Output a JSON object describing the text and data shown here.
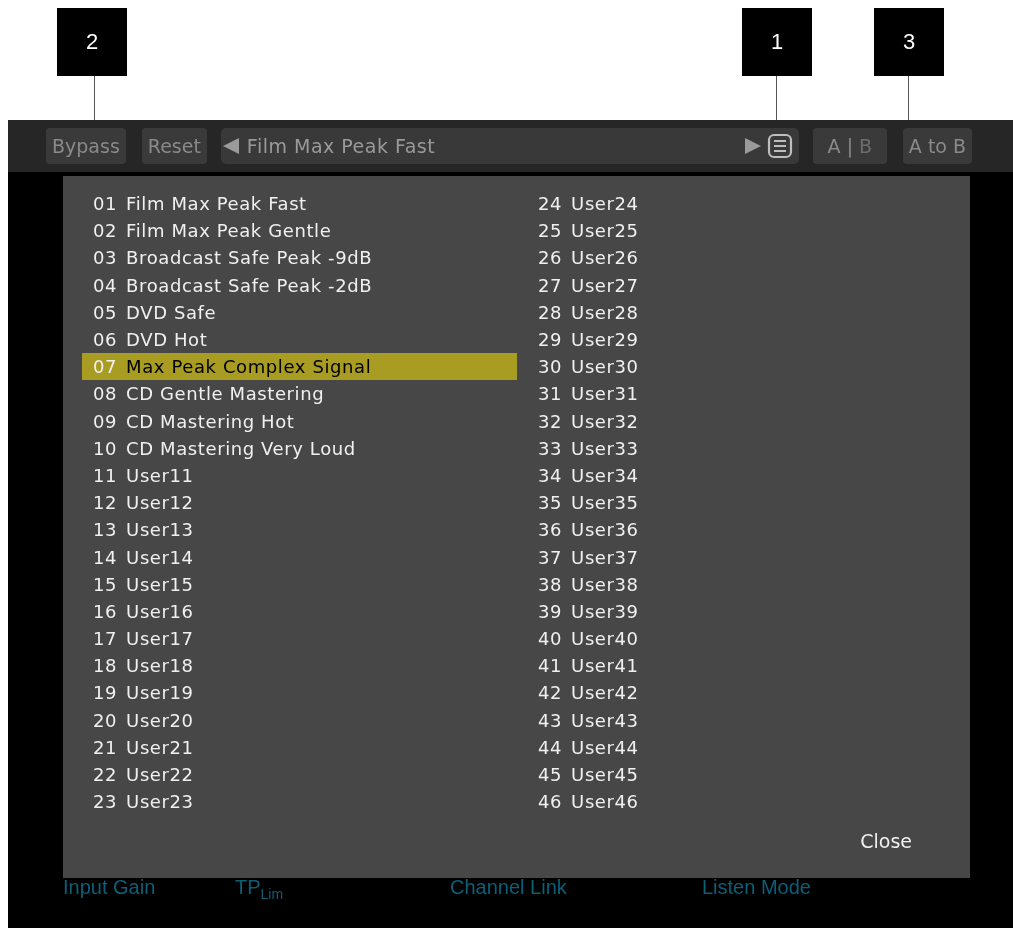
{
  "callouts": [
    "2",
    "1",
    "3"
  ],
  "toolbar": {
    "bypass": "Bypass",
    "reset": "Reset",
    "preset_name": "Film Max Peak Fast",
    "ab": {
      "a": "A",
      "separator": "|",
      "b": "B",
      "b_active": false
    },
    "a_to_b": "A to B"
  },
  "preset_list": {
    "items": [
      {
        "number": "01",
        "name": "Film Max Peak Fast",
        "selected": false
      },
      {
        "number": "02",
        "name": "Film Max Peak Gentle",
        "selected": false
      },
      {
        "number": "03",
        "name": "Broadcast Safe Peak -9dB",
        "selected": false
      },
      {
        "number": "04",
        "name": "Broadcast Safe Peak -2dB",
        "selected": false
      },
      {
        "number": "05",
        "name": "DVD Safe",
        "selected": false
      },
      {
        "number": "06",
        "name": "DVD Hot",
        "selected": false
      },
      {
        "number": "07",
        "name": "Max Peak Complex Signal",
        "selected": true
      },
      {
        "number": "08",
        "name": "CD Gentle Mastering",
        "selected": false
      },
      {
        "number": "09",
        "name": "CD Mastering Hot",
        "selected": false
      },
      {
        "number": "10",
        "name": "CD Mastering Very Loud",
        "selected": false
      },
      {
        "number": "11",
        "name": "User11",
        "selected": false
      },
      {
        "number": "12",
        "name": "User12",
        "selected": false
      },
      {
        "number": "13",
        "name": "User13",
        "selected": false
      },
      {
        "number": "14",
        "name": "User14",
        "selected": false
      },
      {
        "number": "15",
        "name": "User15",
        "selected": false
      },
      {
        "number": "16",
        "name": "User16",
        "selected": false
      },
      {
        "number": "17",
        "name": "User17",
        "selected": false
      },
      {
        "number": "18",
        "name": "User18",
        "selected": false
      },
      {
        "number": "19",
        "name": "User19",
        "selected": false
      },
      {
        "number": "20",
        "name": "User20",
        "selected": false
      },
      {
        "number": "21",
        "name": "User21",
        "selected": false
      },
      {
        "number": "22",
        "name": "User22",
        "selected": false
      },
      {
        "number": "23",
        "name": "User23",
        "selected": false
      },
      {
        "number": "24",
        "name": "User24",
        "selected": false
      },
      {
        "number": "25",
        "name": "User25",
        "selected": false
      },
      {
        "number": "26",
        "name": "User26",
        "selected": false
      },
      {
        "number": "27",
        "name": "User27",
        "selected": false
      },
      {
        "number": "28",
        "name": "User28",
        "selected": false
      },
      {
        "number": "29",
        "name": "User29",
        "selected": false
      },
      {
        "number": "30",
        "name": "User30",
        "selected": false
      },
      {
        "number": "31",
        "name": "User31",
        "selected": false
      },
      {
        "number": "32",
        "name": "User32",
        "selected": false
      },
      {
        "number": "33",
        "name": "User33",
        "selected": false
      },
      {
        "number": "34",
        "name": "User34",
        "selected": false
      },
      {
        "number": "35",
        "name": "User35",
        "selected": false
      },
      {
        "number": "36",
        "name": "User36",
        "selected": false
      },
      {
        "number": "37",
        "name": "User37",
        "selected": false
      },
      {
        "number": "38",
        "name": "User38",
        "selected": false
      },
      {
        "number": "39",
        "name": "User39",
        "selected": false
      },
      {
        "number": "40",
        "name": "User40",
        "selected": false
      },
      {
        "number": "41",
        "name": "User41",
        "selected": false
      },
      {
        "number": "42",
        "name": "User42",
        "selected": false
      },
      {
        "number": "43",
        "name": "User43",
        "selected": false
      },
      {
        "number": "44",
        "name": "User44",
        "selected": false
      },
      {
        "number": "45",
        "name": "User45",
        "selected": false
      },
      {
        "number": "46",
        "name": "User46",
        "selected": false
      }
    ],
    "close": "Close"
  },
  "bottom_labels": [
    "Input Gain",
    "TP$_{Lim}$",
    "Channel Link",
    "Listen Mode"
  ]
}
